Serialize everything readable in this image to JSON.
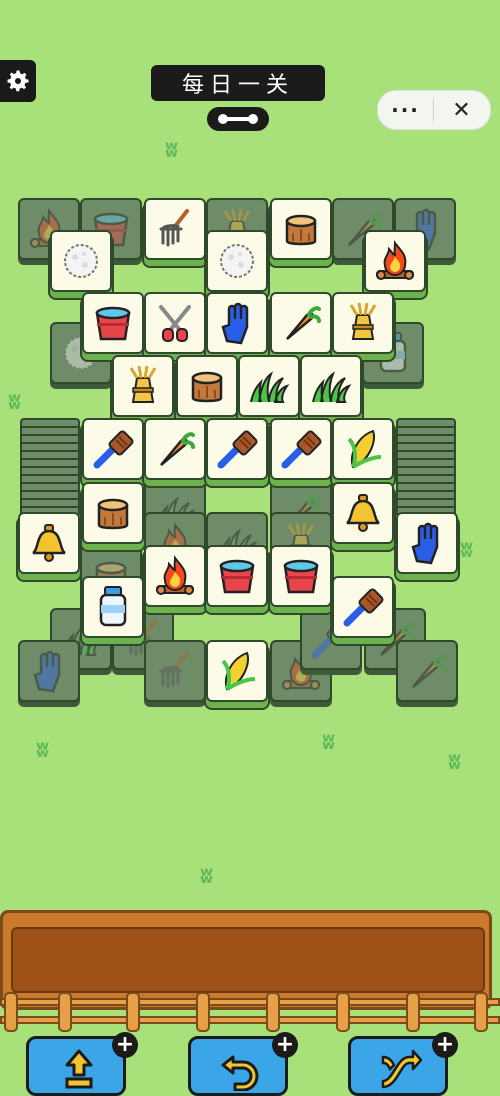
{
  "header": {
    "title": "每日一关",
    "more_label": "···",
    "close_label": "✕"
  },
  "colors": {
    "background": "#a8e07a",
    "tile_face": "#fbfbe8",
    "tile_edge": "#6eb24e",
    "tray": "#c97a2d"
  },
  "icons": {
    "settings": "gear-icon",
    "handle": "connector-icon",
    "tiles": [
      "campfire",
      "bucket",
      "rake",
      "hay",
      "stump",
      "carrot",
      "glove",
      "cotton",
      "scissors",
      "grass",
      "brush",
      "corn",
      "bell",
      "milk",
      "hay-bale"
    ]
  },
  "board": {
    "top_tiles": [
      {
        "icon": "rake"
      },
      {
        "icon": "stump"
      },
      {
        "icon": "cotton"
      },
      {
        "icon": "cotton"
      },
      {
        "icon": "campfire"
      },
      {
        "icon": "bucket"
      },
      {
        "icon": "scissors"
      },
      {
        "icon": "glove"
      },
      {
        "icon": "carrot"
      },
      {
        "icon": "hay"
      },
      {
        "icon": "hay"
      },
      {
        "icon": "stump"
      },
      {
        "icon": "grass"
      },
      {
        "icon": "grass"
      },
      {
        "icon": "brush"
      },
      {
        "icon": "carrot"
      },
      {
        "icon": "brush"
      },
      {
        "icon": "brush"
      },
      {
        "icon": "corn"
      },
      {
        "icon": "stump"
      },
      {
        "icon": "bell"
      },
      {
        "icon": "bell"
      },
      {
        "icon": "glove"
      },
      {
        "icon": "campfire"
      },
      {
        "icon": "bucket"
      },
      {
        "icon": "bucket"
      },
      {
        "icon": "milk"
      },
      {
        "icon": "brush"
      },
      {
        "icon": "corn"
      }
    ]
  },
  "tray": {
    "slots": 7
  },
  "powerups": [
    {
      "name": "move-out",
      "badge": "+"
    },
    {
      "name": "undo",
      "badge": "+"
    },
    {
      "name": "shuffle",
      "badge": "+"
    }
  ]
}
